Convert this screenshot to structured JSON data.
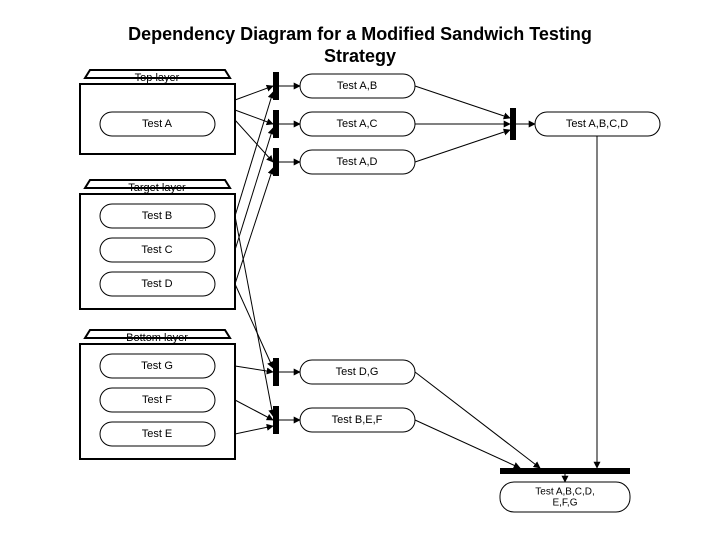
{
  "title_line1": "Dependency Diagram  for  a Modified Sandwich Testing",
  "title_line2": "Strategy",
  "layers": {
    "top": {
      "header": "Top layer",
      "tests": [
        "Test A"
      ]
    },
    "target": {
      "header": "Target layer",
      "tests": [
        "Test B",
        "Test C",
        "Test D"
      ]
    },
    "bottom": {
      "header": "Bottom layer",
      "tests": [
        "Test G",
        "Test F",
        "Test E"
      ]
    }
  },
  "pair_tests_top": [
    "Test A,B",
    "Test A,C",
    "Test A,D"
  ],
  "pair_tests_bottom": [
    "Test D,G",
    "Test B,E,F"
  ],
  "combined_top": "Test A,B,C,D",
  "combined_final1": "Test A,B,C,D,",
  "combined_final2": "E,F,G"
}
